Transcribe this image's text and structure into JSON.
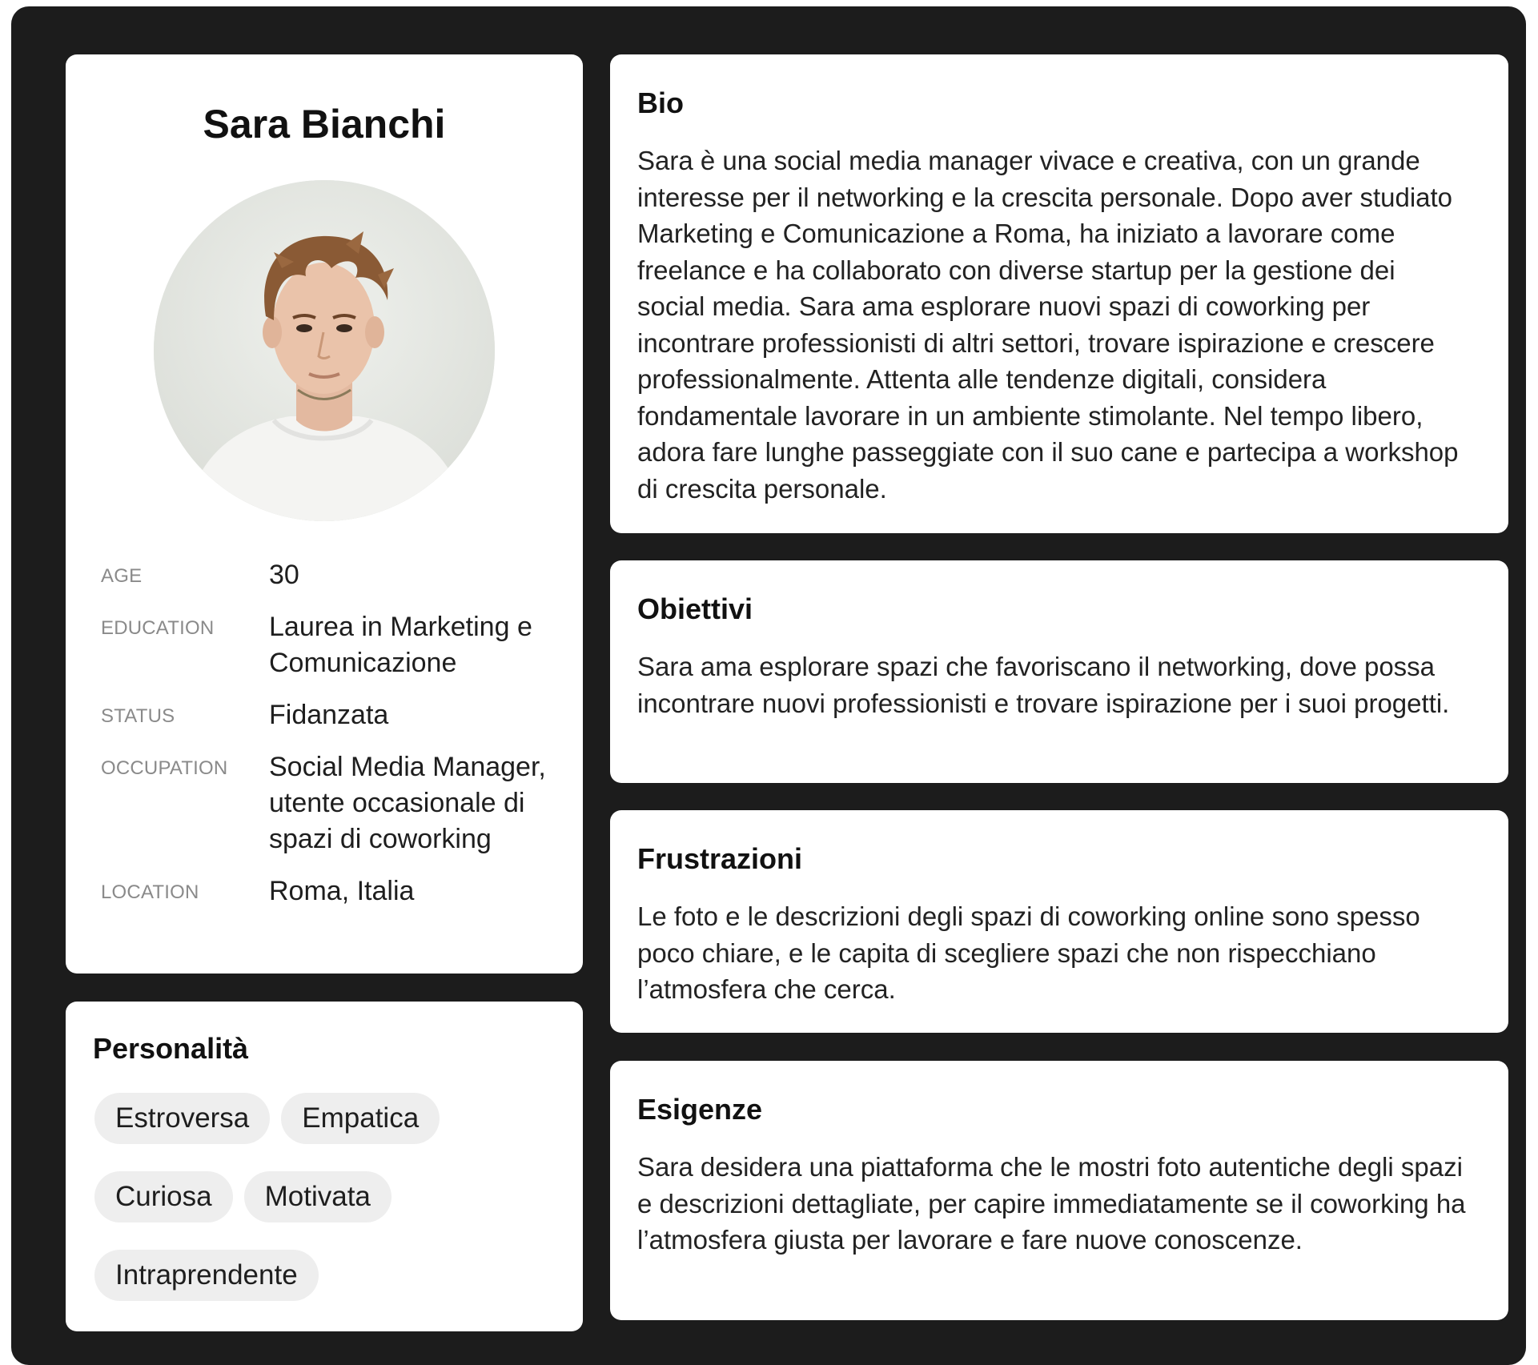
{
  "profile": {
    "name": "Sara Bianchi",
    "fields": [
      {
        "label": "AGE",
        "value": "30"
      },
      {
        "label": "EDUCATION",
        "value": "Laurea in Marketing e Comunicazione"
      },
      {
        "label": "STATUS",
        "value": "Fidanzata"
      },
      {
        "label": "OCCUPATION",
        "value": "Social Media Manager, utente occasionale di spazi di coworking"
      },
      {
        "label": "LOCATION",
        "value": "Roma, Italia"
      }
    ]
  },
  "personality": {
    "title": "Personalità",
    "tags": [
      "Estroversa",
      "Empatica",
      "Curiosa",
      "Motivata",
      "Intraprendente"
    ]
  },
  "bio": {
    "title": "Bio",
    "text": "Sara è una social media manager vivace e creativa, con un grande interesse per il networking e la crescita personale. Dopo aver studiato Marketing e Comunicazione a Roma, ha iniziato a lavorare come freelance e ha collaborato con diverse startup per la gestione dei social media. Sara ama esplorare nuovi spazi di coworking per incontrare professionisti di altri settori, trovare ispirazione e crescere professionalmente. Attenta alle tendenze digitali, considera fondamentale lavorare in un ambiente stimolante. Nel tempo libero, adora fare lunghe passeggiate con il suo cane e partecipa a workshop di crescita personale."
  },
  "obiettivi": {
    "title": "Obiettivi",
    "text": "Sara ama esplorare spazi che favoriscano il networking, dove possa incontrare nuovi professionisti e trovare ispirazione per i suoi progetti."
  },
  "frustrazioni": {
    "title": "Frustrazioni",
    "text": "Le foto e le descrizioni degli spazi di coworking online sono spesso poco chiare, e le capita di scegliere spazi che non rispecchiano l’atmosfera che cerca."
  },
  "esigenze": {
    "title": "Esigenze",
    "text": "Sara desidera una piattaforma che le mostri foto autentiche degli spazi e descrizioni dettagliate, per capire immediatamente se il coworking ha l’atmosfera giusta per lavorare e fare nuove conoscenze."
  }
}
